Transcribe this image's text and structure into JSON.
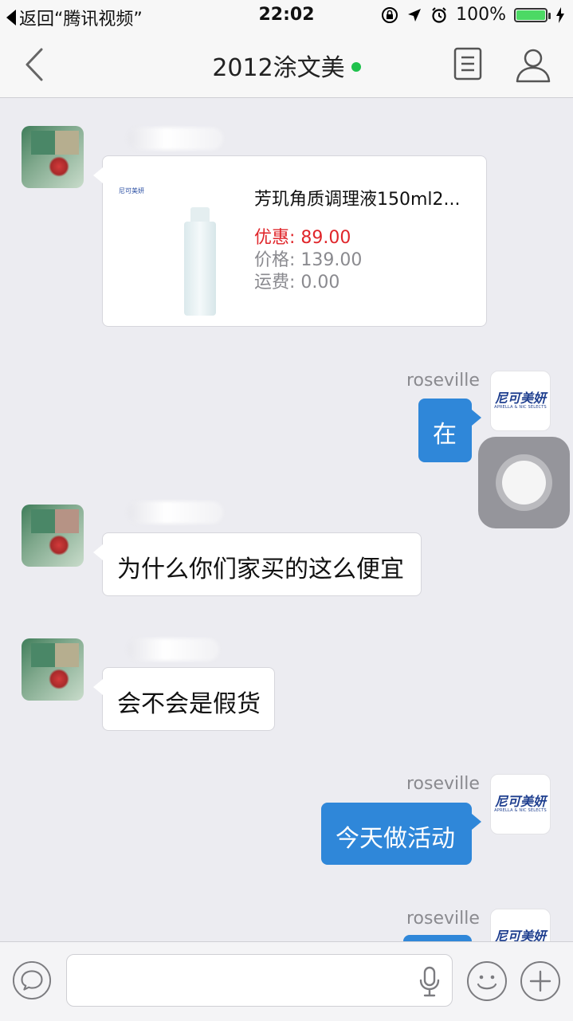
{
  "status_bar": {
    "back_app": "返回“腾讯视频”",
    "time": "22:02",
    "battery_percent": "100%",
    "battery_level": 1.0,
    "icons": [
      "rotation-lock-icon",
      "location-icon",
      "alarm-icon",
      "charging-icon"
    ]
  },
  "nav": {
    "title": "2012涂文美",
    "online_color": "#1fc14d",
    "icons": [
      "back-chevron-icon",
      "document-icon",
      "user-profile-icon"
    ]
  },
  "messages": {
    "product": {
      "brand": "尼可美妍",
      "title": "芳玑角质调理液150ml2...",
      "discount_label": "优惠:",
      "discount_value": "89.00",
      "price_label": "价格:",
      "price_value": "139.00",
      "shipping_label": "运费:",
      "shipping_value": "0.00"
    },
    "reply1": {
      "sender": "roseville",
      "text": "在"
    },
    "question1": {
      "text": "为什么你们家买的这么便宜"
    },
    "question2": {
      "text": "会不会是假货"
    },
    "reply2": {
      "sender": "roseville",
      "text": "今天做活动"
    },
    "reply3": {
      "sender": "roseville"
    },
    "shop_logo": {
      "cn": "尼可美妍",
      "en": "APRELLA & NIC SELECTS"
    }
  },
  "colors": {
    "accent_blue": "#2f87d9",
    "discount_red": "#e0262b",
    "muted": "#8a8a8f",
    "background": "#ececf1"
  },
  "input_bar": {
    "placeholder": "",
    "icons": [
      "chat-bubble-icon",
      "microphone-icon",
      "emoji-icon",
      "plus-icon"
    ]
  }
}
